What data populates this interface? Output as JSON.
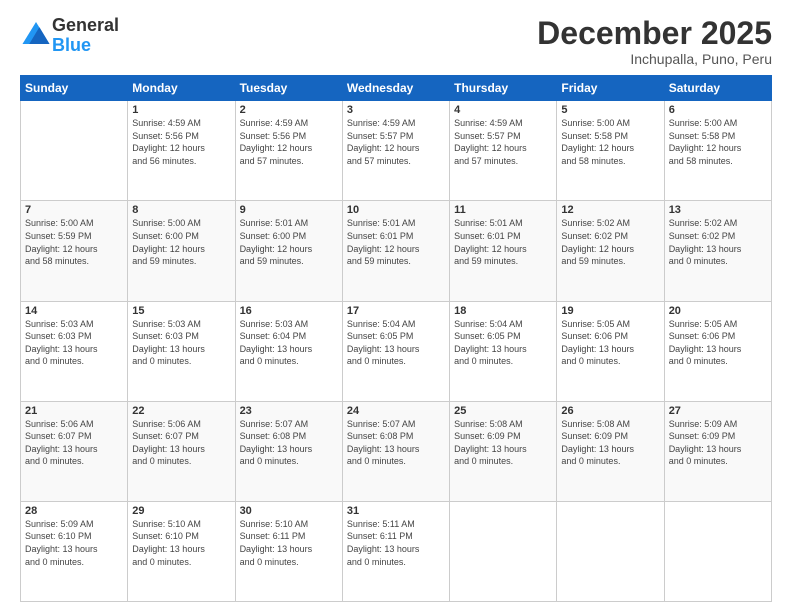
{
  "header": {
    "logo_line1": "General",
    "logo_line2": "Blue",
    "month": "December 2025",
    "location": "Inchupalla, Puno, Peru"
  },
  "weekdays": [
    "Sunday",
    "Monday",
    "Tuesday",
    "Wednesday",
    "Thursday",
    "Friday",
    "Saturday"
  ],
  "weeks": [
    [
      {
        "day": "",
        "info": ""
      },
      {
        "day": "1",
        "info": "Sunrise: 4:59 AM\nSunset: 5:56 PM\nDaylight: 12 hours\nand 56 minutes."
      },
      {
        "day": "2",
        "info": "Sunrise: 4:59 AM\nSunset: 5:56 PM\nDaylight: 12 hours\nand 57 minutes."
      },
      {
        "day": "3",
        "info": "Sunrise: 4:59 AM\nSunset: 5:57 PM\nDaylight: 12 hours\nand 57 minutes."
      },
      {
        "day": "4",
        "info": "Sunrise: 4:59 AM\nSunset: 5:57 PM\nDaylight: 12 hours\nand 57 minutes."
      },
      {
        "day": "5",
        "info": "Sunrise: 5:00 AM\nSunset: 5:58 PM\nDaylight: 12 hours\nand 58 minutes."
      },
      {
        "day": "6",
        "info": "Sunrise: 5:00 AM\nSunset: 5:58 PM\nDaylight: 12 hours\nand 58 minutes."
      }
    ],
    [
      {
        "day": "7",
        "info": "Sunrise: 5:00 AM\nSunset: 5:59 PM\nDaylight: 12 hours\nand 58 minutes."
      },
      {
        "day": "8",
        "info": "Sunrise: 5:00 AM\nSunset: 6:00 PM\nDaylight: 12 hours\nand 59 minutes."
      },
      {
        "day": "9",
        "info": "Sunrise: 5:01 AM\nSunset: 6:00 PM\nDaylight: 12 hours\nand 59 minutes."
      },
      {
        "day": "10",
        "info": "Sunrise: 5:01 AM\nSunset: 6:01 PM\nDaylight: 12 hours\nand 59 minutes."
      },
      {
        "day": "11",
        "info": "Sunrise: 5:01 AM\nSunset: 6:01 PM\nDaylight: 12 hours\nand 59 minutes."
      },
      {
        "day": "12",
        "info": "Sunrise: 5:02 AM\nSunset: 6:02 PM\nDaylight: 12 hours\nand 59 minutes."
      },
      {
        "day": "13",
        "info": "Sunrise: 5:02 AM\nSunset: 6:02 PM\nDaylight: 13 hours\nand 0 minutes."
      }
    ],
    [
      {
        "day": "14",
        "info": "Sunrise: 5:03 AM\nSunset: 6:03 PM\nDaylight: 13 hours\nand 0 minutes."
      },
      {
        "day": "15",
        "info": "Sunrise: 5:03 AM\nSunset: 6:03 PM\nDaylight: 13 hours\nand 0 minutes."
      },
      {
        "day": "16",
        "info": "Sunrise: 5:03 AM\nSunset: 6:04 PM\nDaylight: 13 hours\nand 0 minutes."
      },
      {
        "day": "17",
        "info": "Sunrise: 5:04 AM\nSunset: 6:05 PM\nDaylight: 13 hours\nand 0 minutes."
      },
      {
        "day": "18",
        "info": "Sunrise: 5:04 AM\nSunset: 6:05 PM\nDaylight: 13 hours\nand 0 minutes."
      },
      {
        "day": "19",
        "info": "Sunrise: 5:05 AM\nSunset: 6:06 PM\nDaylight: 13 hours\nand 0 minutes."
      },
      {
        "day": "20",
        "info": "Sunrise: 5:05 AM\nSunset: 6:06 PM\nDaylight: 13 hours\nand 0 minutes."
      }
    ],
    [
      {
        "day": "21",
        "info": "Sunrise: 5:06 AM\nSunset: 6:07 PM\nDaylight: 13 hours\nand 0 minutes."
      },
      {
        "day": "22",
        "info": "Sunrise: 5:06 AM\nSunset: 6:07 PM\nDaylight: 13 hours\nand 0 minutes."
      },
      {
        "day": "23",
        "info": "Sunrise: 5:07 AM\nSunset: 6:08 PM\nDaylight: 13 hours\nand 0 minutes."
      },
      {
        "day": "24",
        "info": "Sunrise: 5:07 AM\nSunset: 6:08 PM\nDaylight: 13 hours\nand 0 minutes."
      },
      {
        "day": "25",
        "info": "Sunrise: 5:08 AM\nSunset: 6:09 PM\nDaylight: 13 hours\nand 0 minutes."
      },
      {
        "day": "26",
        "info": "Sunrise: 5:08 AM\nSunset: 6:09 PM\nDaylight: 13 hours\nand 0 minutes."
      },
      {
        "day": "27",
        "info": "Sunrise: 5:09 AM\nSunset: 6:09 PM\nDaylight: 13 hours\nand 0 minutes."
      }
    ],
    [
      {
        "day": "28",
        "info": "Sunrise: 5:09 AM\nSunset: 6:10 PM\nDaylight: 13 hours\nand 0 minutes."
      },
      {
        "day": "29",
        "info": "Sunrise: 5:10 AM\nSunset: 6:10 PM\nDaylight: 13 hours\nand 0 minutes."
      },
      {
        "day": "30",
        "info": "Sunrise: 5:10 AM\nSunset: 6:11 PM\nDaylight: 13 hours\nand 0 minutes."
      },
      {
        "day": "31",
        "info": "Sunrise: 5:11 AM\nSunset: 6:11 PM\nDaylight: 13 hours\nand 0 minutes."
      },
      {
        "day": "",
        "info": ""
      },
      {
        "day": "",
        "info": ""
      },
      {
        "day": "",
        "info": ""
      }
    ]
  ]
}
